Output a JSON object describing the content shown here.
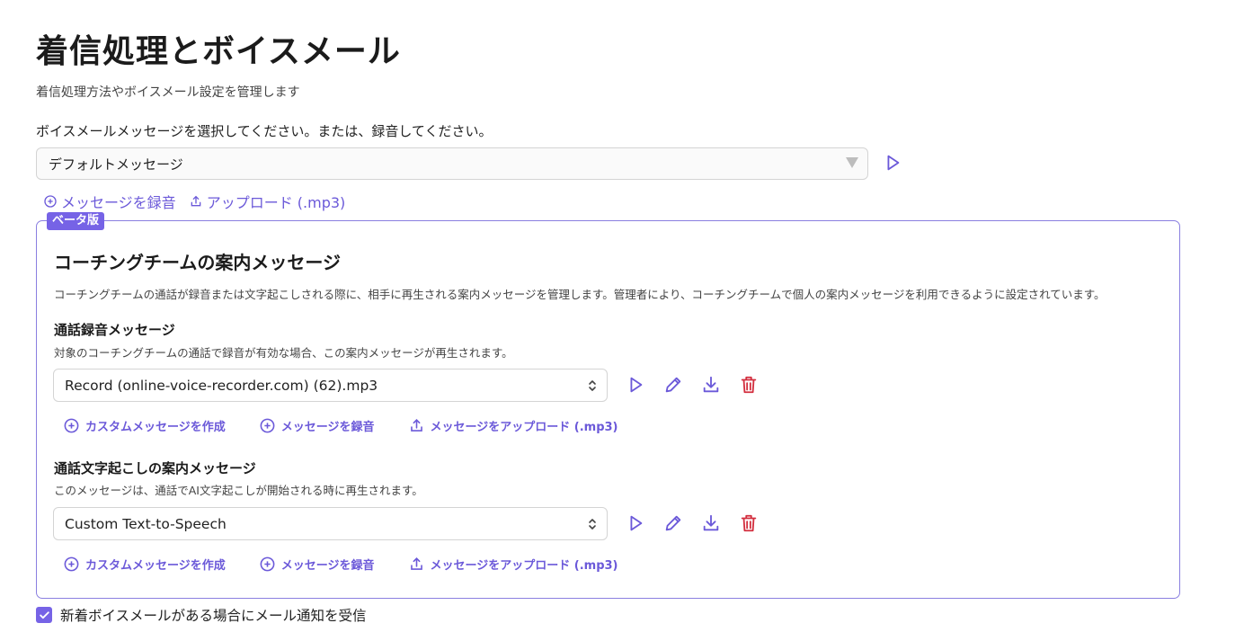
{
  "page": {
    "title": "着信処理とボイスメール",
    "subtitle": "着信処理方法やボイスメール設定を管理します"
  },
  "voicemail": {
    "label": "ボイスメールメッセージを選択してください。または、録音してください。",
    "selected": "デフォルトメッセージ",
    "record_label": "メッセージを録音",
    "upload_label": "アップロード (.mp3)"
  },
  "coaching": {
    "badge": "ベータ版",
    "title": "コーチングチームの案内メッセージ",
    "description": "コーチングチームの通話が録音または文字起こしされる際に、相手に再生される案内メッセージを管理します。管理者により、コーチングチームで個人の案内メッセージを利用できるように設定されています。",
    "recording": {
      "title": "通話録音メッセージ",
      "description": "対象のコーチングチームの通話で録音が有効な場合、この案内メッセージが再生されます。",
      "selected": "Record (online-voice-recorder.com) (62).mp3",
      "create_label": "カスタムメッセージを作成",
      "record_label": "メッセージを録音",
      "upload_label": "メッセージをアップロード (.mp3)"
    },
    "transcription": {
      "title": "通話文字起こしの案内メッセージ",
      "description": "このメッセージは、通話でAI文字起こしが開始される時に再生されます。",
      "selected": "Custom Text-to-Speech",
      "create_label": "カスタムメッセージを作成",
      "record_label": "メッセージを録音",
      "upload_label": "メッセージをアップロード (.mp3)"
    }
  },
  "notification": {
    "label": "新着ボイスメールがある場合にメール通知を受信",
    "checked": true
  },
  "colors": {
    "accent": "#7663e6",
    "link": "#6b59d9",
    "danger": "#d32f3f",
    "border": "#d4d4d4"
  },
  "icons": [
    "play-icon",
    "plus-circle-icon",
    "upload-icon",
    "pencil-icon",
    "download-icon",
    "trash-icon",
    "chevron-updown-icon",
    "check-icon"
  ]
}
